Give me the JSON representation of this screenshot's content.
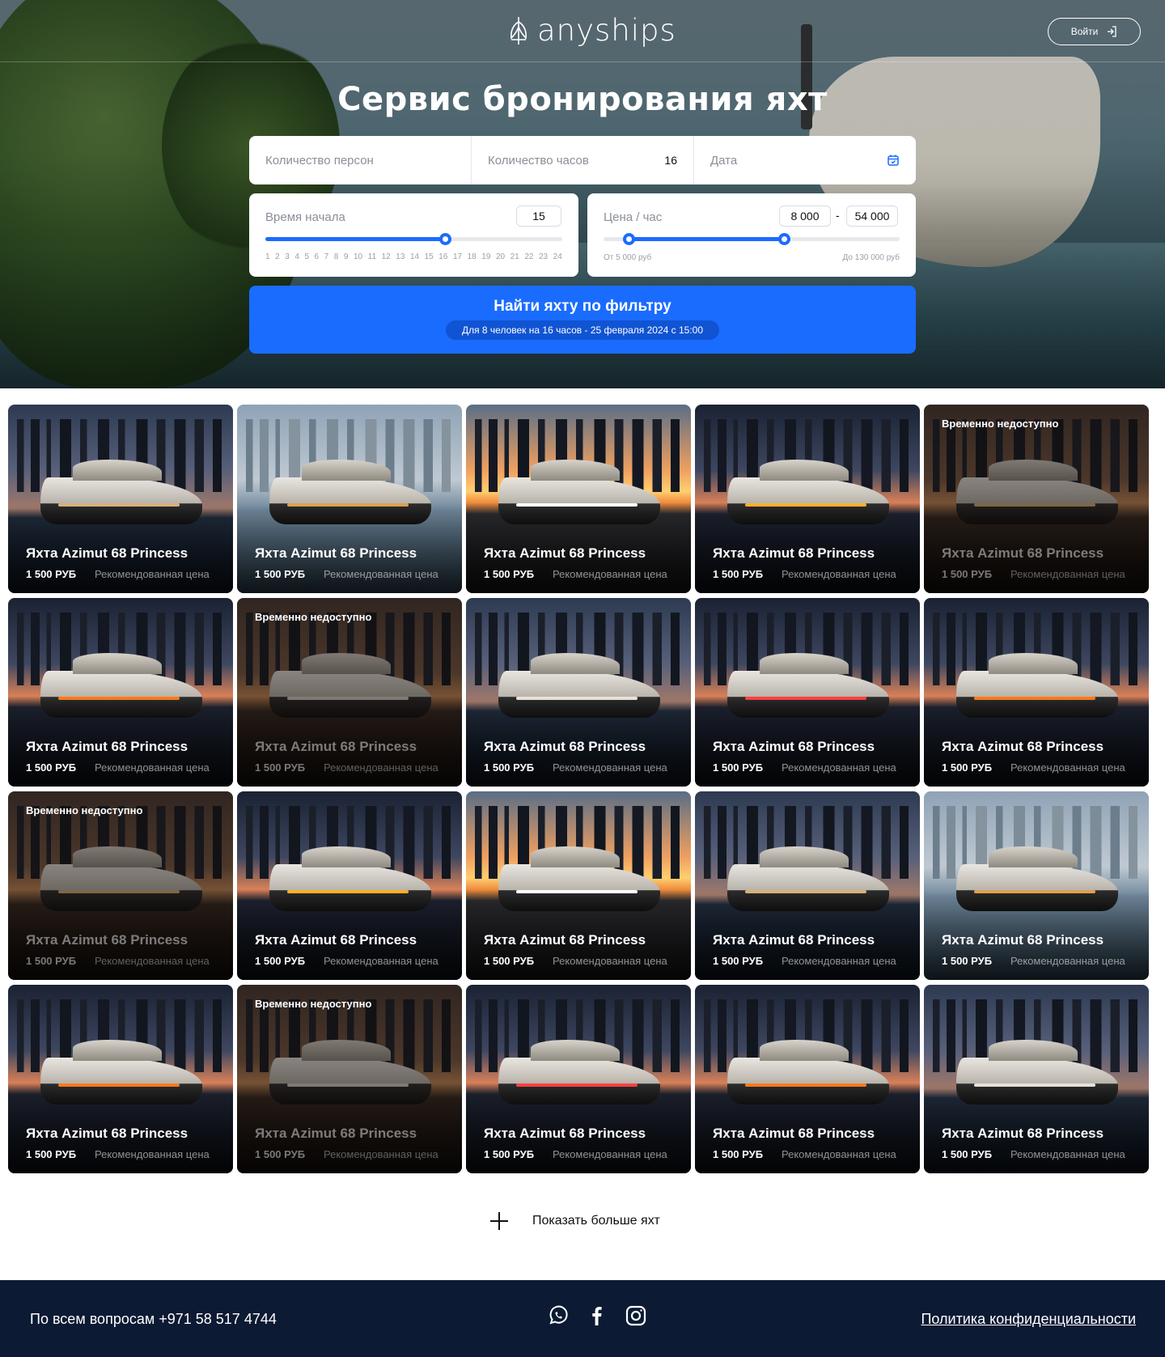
{
  "header": {
    "logo_text": "anyships",
    "login_label": "Войти"
  },
  "hero": {
    "title": "Сервис бронирования яхт"
  },
  "filters": {
    "persons_placeholder": "Количество персон",
    "hours_label": "Количество часов",
    "hours_value": "16",
    "date_placeholder": "Дата"
  },
  "start_time": {
    "label": "Время начала",
    "value": "15",
    "ticks": [
      "1",
      "2",
      "3",
      "4",
      "5",
      "6",
      "7",
      "8",
      "9",
      "10",
      "11",
      "12",
      "13",
      "14",
      "15",
      "16",
      "17",
      "18",
      "19",
      "20",
      "21",
      "22",
      "23",
      "24"
    ]
  },
  "price": {
    "label": "Цена / час",
    "min_value": "8 000",
    "separator": "-",
    "max_value": "54 000",
    "from_label": "От 5 000 руб",
    "to_label": "До 130 000 руб"
  },
  "search": {
    "button_label": "Найти яхту по фильтру",
    "summary": "Для 8 человек на 16 часов - 25 февраля 2024 с 15:00"
  },
  "yachts": [
    {
      "title": "Яхта Azimut 68 Princess",
      "price": "1 500 РУБ",
      "note": "Рекомендованная цена",
      "unavailable": ""
    },
    {
      "title": "Яхта Azimut 68 Princess",
      "price": "1 500 РУБ",
      "note": "Рекомендованная цена",
      "unavailable": ""
    },
    {
      "title": "Яхта Azimut 68 Princess",
      "price": "1 500 РУБ",
      "note": "Рекомендованная цена",
      "unavailable": ""
    },
    {
      "title": "Яхта Azimut 68 Princess",
      "price": "1 500 РУБ",
      "note": "Рекомендованная цена",
      "unavailable": ""
    },
    {
      "title": "Яхта Azimut 68 Princess",
      "price": "1 500 РУБ",
      "note": "Рекомендованная цена",
      "unavailable": "Временно недоступно"
    },
    {
      "title": "Яхта Azimut 68 Princess",
      "price": "1 500 РУБ",
      "note": "Рекомендованная цена",
      "unavailable": ""
    },
    {
      "title": "Яхта Azimut 68 Princess",
      "price": "1 500 РУБ",
      "note": "Рекомендованная цена",
      "unavailable": "Временно недоступно"
    },
    {
      "title": "Яхта Azimut 68 Princess",
      "price": "1 500 РУБ",
      "note": "Рекомендованная цена",
      "unavailable": ""
    },
    {
      "title": "Яхта Azimut 68 Princess",
      "price": "1 500 РУБ",
      "note": "Рекомендованная цена",
      "unavailable": ""
    },
    {
      "title": "Яхта Azimut 68 Princess",
      "price": "1 500 РУБ",
      "note": "Рекомендованная цена",
      "unavailable": ""
    },
    {
      "title": "Яхта Azimut 68 Princess",
      "price": "1 500 РУБ",
      "note": "Рекомендованная цена",
      "unavailable": "Временно недоступно"
    },
    {
      "title": "Яхта Azimut 68 Princess",
      "price": "1 500 РУБ",
      "note": "Рекомендованная цена",
      "unavailable": ""
    },
    {
      "title": "Яхта Azimut 68 Princess",
      "price": "1 500 РУБ",
      "note": "Рекомендованная цена",
      "unavailable": ""
    },
    {
      "title": "Яхта Azimut 68 Princess",
      "price": "1 500 РУБ",
      "note": "Рекомендованная цена",
      "unavailable": ""
    },
    {
      "title": "Яхта Azimut 68 Princess",
      "price": "1 500 РУБ",
      "note": "Рекомендованная цена",
      "unavailable": ""
    },
    {
      "title": "Яхта Azimut 68 Princess",
      "price": "1 500 РУБ",
      "note": "Рекомендованная цена",
      "unavailable": ""
    },
    {
      "title": "Яхта Azimut 68 Princess",
      "price": "1 500 РУБ",
      "note": "Рекомендованная цена",
      "unavailable": "Временно недоступно"
    },
    {
      "title": "Яхта Azimut 68 Princess",
      "price": "1 500 РУБ",
      "note": "Рекомендованная цена",
      "unavailable": ""
    },
    {
      "title": "Яхта Azimut 68 Princess",
      "price": "1 500 РУБ",
      "note": "Рекомендованная цена",
      "unavailable": ""
    },
    {
      "title": "Яхта Azimut 68 Princess",
      "price": "1 500 РУБ",
      "note": "Рекомендованная цена",
      "unavailable": ""
    }
  ],
  "more": {
    "label": "Показать больше яхт"
  },
  "footer": {
    "contact": "По всем вопросам +971 58 517 4744",
    "policy": "Политика конфиденциальности",
    "social": [
      "whatsapp-icon",
      "facebook-icon",
      "instagram-icon"
    ]
  },
  "colors": {
    "accent": "#1a6cff",
    "footer_bg": "#0c1a33"
  }
}
